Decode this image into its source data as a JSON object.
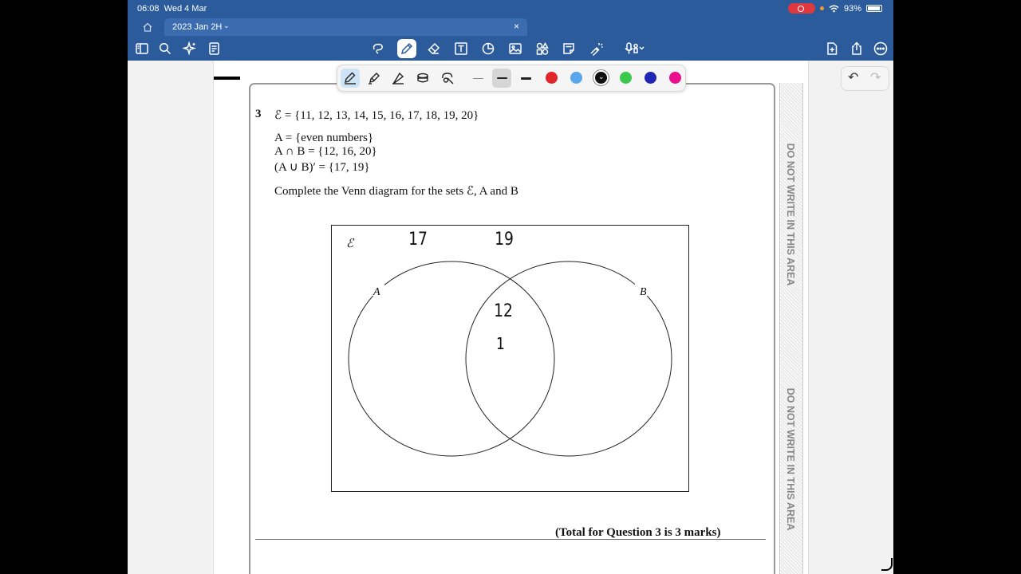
{
  "status": {
    "time": "06:08",
    "date": "Wed 4 Mar",
    "battery": "93%"
  },
  "tab": {
    "title": "2023 Jan 2H"
  },
  "toolbar": {
    "left_icons": [
      "sidebar-icon",
      "search-icon",
      "sparkle-icon",
      "document-list-icon"
    ],
    "center_icons": [
      "lasso-icon",
      "pen-icon",
      "eraser-icon",
      "text-box-icon",
      "shapes-icon",
      "image-icon",
      "elements-icon",
      "sticky-note-icon",
      "laser-pointer-icon",
      "microphone-icon"
    ],
    "right_icons": [
      "add-page-icon",
      "share-icon",
      "more-icon"
    ],
    "active": "pen-icon"
  },
  "pen_toolbar": {
    "tools": [
      "pen-tool-icon",
      "highlighter-icon",
      "fountain-pen-icon",
      "eraser-tool-icon",
      "lasso-tool-icon"
    ],
    "active_tool": "pen-tool-icon",
    "strokes": [
      "thin",
      "medium",
      "thick"
    ],
    "active_stroke": "medium",
    "colors": [
      "#e0262b",
      "#5aa6ec",
      "#111111",
      "#3cc84a",
      "#1d27b3",
      "#ea0f8a"
    ],
    "selected_color": "#111111"
  },
  "question": {
    "number": "3",
    "universal_set": "ℰ = {11, 12, 13, 14, 15, 16, 17, 18, 19, 20}",
    "set_a": "A = {even numbers}",
    "intersection": "A ∩ B = {12, 16, 20}",
    "complement": "(A ∪ B)′ = {17, 19}",
    "instruction": "Complete the Venn diagram for the sets ℰ, A and B",
    "total": "(Total for Question 3 is 3 marks)"
  },
  "venn": {
    "universal_label": "ℰ",
    "label_a": "A",
    "label_b": "B",
    "handwritten_outside": [
      "17",
      "19"
    ],
    "handwritten_intersection": [
      "12",
      "1"
    ]
  },
  "margin_text": "DO NOT WRITE IN THIS AREA"
}
